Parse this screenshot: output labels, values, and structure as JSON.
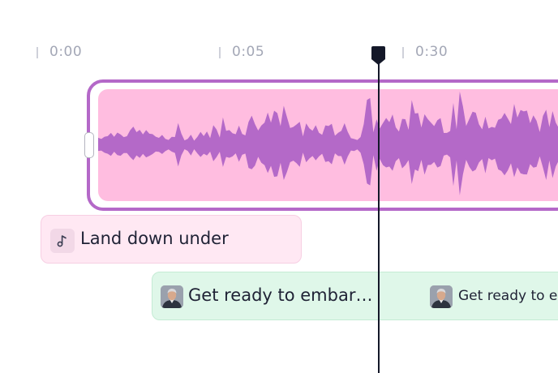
{
  "timeline": {
    "ruler_labels": [
      "0:00",
      "0:05",
      "0:30"
    ]
  },
  "tracks": {
    "music": {
      "label": "Land down under",
      "icon": "music-note-icon"
    },
    "voice": {
      "segments": [
        {
          "label": "Get ready to embar…"
        },
        {
          "label": "Get ready to em"
        }
      ],
      "avatar_icon": "person-avatar"
    }
  },
  "colors": {
    "audio_border": "#b468c8",
    "audio_fill": "#ffbde0",
    "waveform": "#b469c8",
    "music_bg": "#ffe8f3",
    "voice_bg": "#dff7e9",
    "playhead": "#141829"
  }
}
